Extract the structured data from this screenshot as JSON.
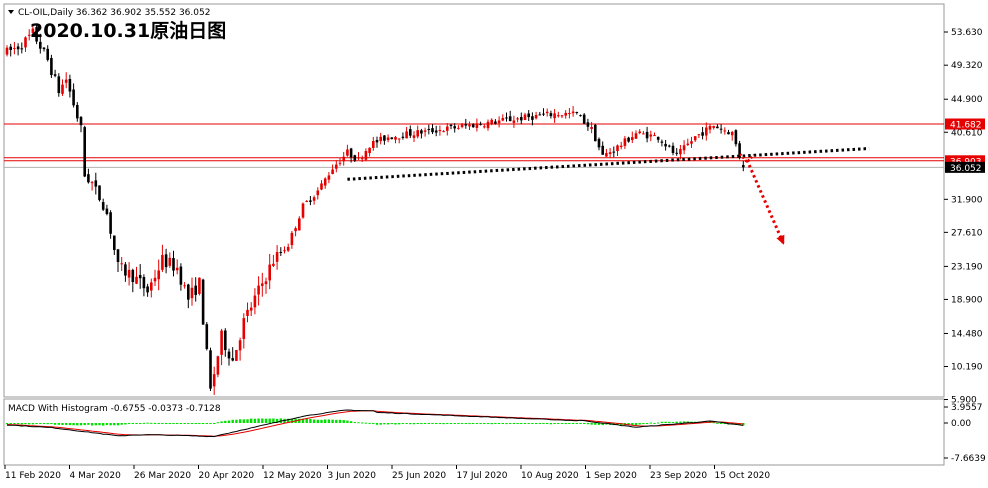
{
  "window": {
    "header": "CL-OIL,Daily  36.362 36.902 35.552 36.052",
    "overlay_title": "2020.10.31原油日图"
  },
  "chart_data": [
    {
      "type": "candlestick",
      "symbol": "CL-OIL",
      "timeframe": "Daily",
      "last_bar": {
        "open": 36.362,
        "high": 36.902,
        "low": 35.552,
        "close": 36.052
      },
      "y_ticks": [
        "53.630",
        "49.320",
        "44.900",
        "40.610",
        "36.052",
        "31.900",
        "27.610",
        "23.190",
        "18.900",
        "14.480",
        "10.190",
        "5.900"
      ],
      "ylim": [
        5.9,
        56.0
      ],
      "x_ticks": [
        "11 Feb 2020",
        "4 Mar 2020",
        "26 Mar 2020",
        "20 Apr 2020",
        "12 May 2020",
        "3 Jun 2020",
        "25 Jun 2020",
        "17 Jul 2020",
        "10 Aug 2020",
        "1 Sep 2020",
        "23 Sep 2020",
        "15 Oct 2020"
      ],
      "price_labels": [
        {
          "text": "41.682",
          "value": 41.682,
          "color": "#e60000"
        },
        {
          "text": "36.903",
          "value": 36.903,
          "color": "#e60000"
        },
        {
          "text": "36.052",
          "value": 36.052,
          "color": "#000000"
        }
      ],
      "horizontal_lines": [
        41.682,
        37.3,
        36.903
      ],
      "anchors": [
        {
          "d": 0,
          "p": 51
        },
        {
          "d": 4,
          "p": 52
        },
        {
          "d": 7,
          "p": 53.5
        },
        {
          "d": 11,
          "p": 50
        },
        {
          "d": 14,
          "p": 46
        },
        {
          "d": 16,
          "p": 47.5
        },
        {
          "d": 20,
          "p": 41
        },
        {
          "d": 21,
          "p": 35
        },
        {
          "d": 23,
          "p": 34
        },
        {
          "d": 27,
          "p": 30
        },
        {
          "d": 30,
          "p": 23
        },
        {
          "d": 34,
          "p": 22
        },
        {
          "d": 38,
          "p": 20
        },
        {
          "d": 42,
          "p": 24
        },
        {
          "d": 46,
          "p": 23
        },
        {
          "d": 49,
          "p": 19
        },
        {
          "d": 52,
          "p": 21
        },
        {
          "d": 55,
          "p": 7
        },
        {
          "d": 58,
          "p": 14
        },
        {
          "d": 61,
          "p": 11
        },
        {
          "d": 64,
          "p": 16
        },
        {
          "d": 68,
          "p": 20
        },
        {
          "d": 72,
          "p": 24
        },
        {
          "d": 76,
          "p": 26
        },
        {
          "d": 80,
          "p": 31
        },
        {
          "d": 84,
          "p": 33
        },
        {
          "d": 88,
          "p": 36
        },
        {
          "d": 92,
          "p": 38
        },
        {
          "d": 95,
          "p": 37
        },
        {
          "d": 98,
          "p": 39
        },
        {
          "d": 103,
          "p": 40
        },
        {
          "d": 110,
          "p": 40.5
        },
        {
          "d": 118,
          "p": 41
        },
        {
          "d": 125,
          "p": 41.5
        },
        {
          "d": 132,
          "p": 42
        },
        {
          "d": 140,
          "p": 42.5
        },
        {
          "d": 148,
          "p": 43
        },
        {
          "d": 154,
          "p": 43
        },
        {
          "d": 158,
          "p": 41
        },
        {
          "d": 161,
          "p": 37.5
        },
        {
          "d": 166,
          "p": 39
        },
        {
          "d": 170,
          "p": 40.5
        },
        {
          "d": 176,
          "p": 40
        },
        {
          "d": 181,
          "p": 37.5
        },
        {
          "d": 186,
          "p": 40
        },
        {
          "d": 191,
          "p": 41.5
        },
        {
          "d": 196,
          "p": 40.5
        },
        {
          "d": 198,
          "p": 37.5
        },
        {
          "d": 199,
          "p": 36
        }
      ]
    },
    {
      "type": "line",
      "name": "MACD With Histogram",
      "header": "MACD With Histogram -0.6755 -0.0373 -0.7128",
      "values": {
        "macd": -0.6755,
        "signal": -0.0373,
        "histogram": -0.7128
      },
      "y_ticks": [
        "3.9557",
        "0.00",
        "-7.6639"
      ],
      "ylim": [
        -7.6639,
        3.9557
      ]
    }
  ],
  "annotations": [
    {
      "kind": "dotted-trendline",
      "color": "#000000",
      "from": {
        "d": 92,
        "p": 34.5
      },
      "to": {
        "d": 233,
        "p": 38.5
      }
    },
    {
      "kind": "dotted-arrow",
      "color": "#e60000",
      "from": {
        "d": 200,
        "p": 37
      },
      "to": {
        "d": 210,
        "p": 26
      }
    }
  ]
}
